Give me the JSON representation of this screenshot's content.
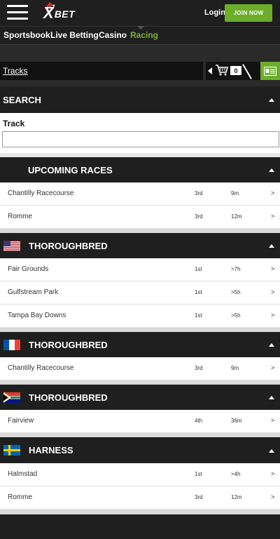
{
  "header": {
    "logo_x": "X",
    "logo_bet": "BET",
    "login_label": "Login",
    "join_label": "JOIN NOW"
  },
  "nav": {
    "items": [
      "Sportsbook",
      "Live Betting",
      "Casino",
      "Racing"
    ],
    "active": "Racing"
  },
  "tracks_bar": {
    "tracks_label": "Tracks",
    "cart_count": "0"
  },
  "search": {
    "title": "SEARCH",
    "field_label": "Track",
    "field_value": "",
    "field_placeholder": ""
  },
  "sections": [
    {
      "title": "UPCOMING RACES",
      "flag": "",
      "rows": [
        {
          "name": "Chantilly Racecourse",
          "race": "3rd",
          "time": "9m",
          "arrow": ">"
        },
        {
          "name": "Romme",
          "race": "3rd",
          "time": "12m",
          "arrow": ">"
        }
      ]
    },
    {
      "title": "THOROUGHBRED",
      "flag": "us-flag-icon",
      "rows": [
        {
          "name": "Fair Grounds",
          "race": "1st",
          "time": ">7h",
          "arrow": ">"
        },
        {
          "name": "Gulfstream Park",
          "race": "1st",
          "time": ">5h",
          "arrow": ">"
        },
        {
          "name": "Tampa Bay Downs",
          "race": "1st",
          "time": ">5h",
          "arrow": ">"
        }
      ]
    },
    {
      "title": "THOROUGHBRED",
      "flag": "france-flag-icon",
      "rows": [
        {
          "name": "Chantilly Racecourse",
          "race": "3rd",
          "time": "9m",
          "arrow": ">"
        }
      ]
    },
    {
      "title": "THOROUGHBRED",
      "flag": "south-africa-flag-icon",
      "rows": [
        {
          "name": "Fairview",
          "race": "4th",
          "time": "36m",
          "arrow": ">"
        }
      ]
    },
    {
      "title": "HARNESS",
      "flag": "sweden-flag-icon",
      "rows": [
        {
          "name": "Halmstad",
          "race": "1st",
          "time": ">4h",
          "arrow": ">"
        },
        {
          "name": "Romme",
          "race": "3rd",
          "time": "12m",
          "arrow": ">"
        }
      ]
    }
  ],
  "colors": {
    "dark": "#1f1f1f",
    "accent_green": "#6cae2a",
    "active_nav": "#7cae3a"
  }
}
